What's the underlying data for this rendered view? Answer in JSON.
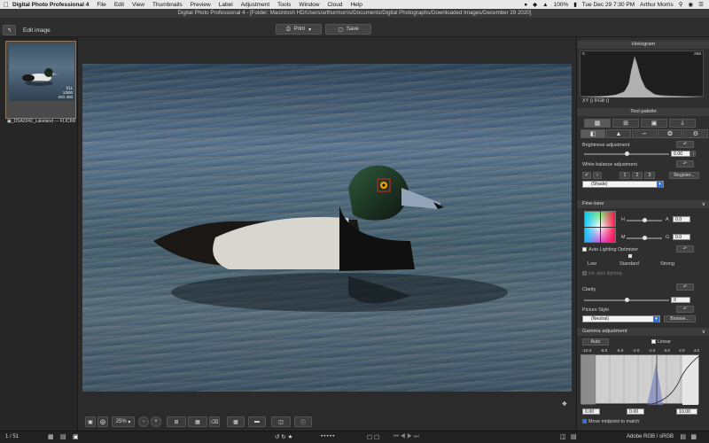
{
  "menubar": {
    "app_name": "Digital Photo Professional 4",
    "items": [
      "File",
      "Edit",
      "View",
      "Thumbnails",
      "Preview",
      "Label",
      "Adjustment",
      "Tools",
      "Window",
      "Cloud",
      "Help"
    ],
    "battery": "100%",
    "datetime": "Tue Dec 29  7:30 PM",
    "user": "Arthur Morris"
  },
  "window": {
    "title": "Digital Photo Professional 4 - [Folder: Macintosh HD/Users/arthurmorris/Documents/Digital Photographs/Downloaded Images/December 29 2020]"
  },
  "toolbar": {
    "back_label": "↰",
    "mode_label": "Edit image",
    "print_label": "Print",
    "save_label": "Save"
  },
  "filmstrip": {
    "thumb_label": "▣_DSA0342_Lakeland — FLICKR",
    "thumb_meta": [
      "f/11",
      "1/500",
      "ISO 400"
    ]
  },
  "viewer": {
    "zoom": "25%",
    "page_info": "1 / 51",
    "color_space": "Adobe RGB / sRGB"
  },
  "histogram": {
    "title": "Histogram",
    "max_label": "255",
    "min_label": "0",
    "xy_label": "XY (",
    "rgb_label": ")  RGB (",
    "end_label": ")"
  },
  "tool_palette": {
    "title": "Tool palette",
    "brightness_label": "Brightness adjustment",
    "brightness_value": "0.00",
    "brightness_level": 0.5,
    "wb_label": "White balance adjustment",
    "wb_buttons": [
      "1",
      "2",
      "3"
    ],
    "wb_register": "Register...",
    "wb_preset": "(Shade)"
  },
  "finetune": {
    "title": "Fine-tune",
    "h_label": "H",
    "a_label": "A",
    "a_value": "0.0",
    "m_label": "M",
    "g_label": "G",
    "g_value": "0.0",
    "alo_label": "Auto Lighting Optimizer",
    "alo_levels": [
      "Low",
      "Standard",
      "Strong"
    ],
    "ink_label": "Ink dark lighting",
    "clarity_label": "Clarity",
    "clarity_value": "0",
    "picture_style_label": "Picture Style",
    "picture_style_value": "(Neutral)",
    "browse_label": "Browse..."
  },
  "gamma": {
    "title": "Gamma adjustment",
    "auto_label": "Auto",
    "linear_label": "Linear",
    "ticks": [
      "-10.0",
      "-8.0",
      "-6.0",
      "-4.0",
      "-2.0",
      "0.0",
      "2.0",
      "4.0"
    ],
    "left_value": "0.00",
    "mid_value": "0.00",
    "right_value": "10.00",
    "move_midpoint_label": "Move midpoint to match"
  },
  "colors": {
    "accent": "#2f6fe0",
    "red_point": "#e02020"
  }
}
